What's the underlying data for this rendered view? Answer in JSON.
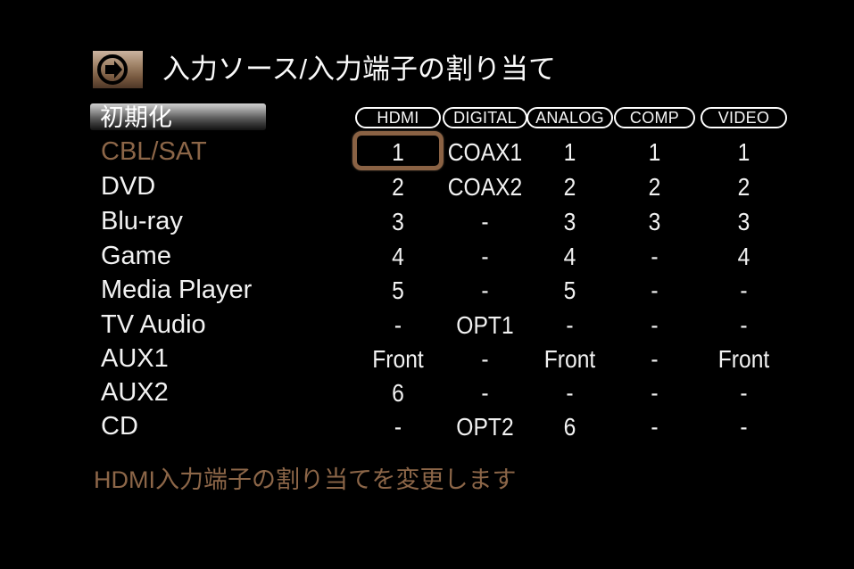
{
  "header": {
    "title": "入力ソース/入力端子の割り当て",
    "icon": "arrow-right-card-icon"
  },
  "highlight_row": {
    "label": "初期化"
  },
  "table": {
    "columns": [
      "HDMI",
      "DIGITAL",
      "ANALOG",
      "COMP",
      "VIDEO"
    ],
    "rows": [
      {
        "source": "CBL/SAT",
        "selected": true,
        "values": [
          "1",
          "COAX1",
          "1",
          "1",
          "1"
        ]
      },
      {
        "source": "DVD",
        "selected": false,
        "values": [
          "2",
          "COAX2",
          "2",
          "2",
          "2"
        ]
      },
      {
        "source": "Blu-ray",
        "selected": false,
        "values": [
          "3",
          "-",
          "3",
          "3",
          "3"
        ]
      },
      {
        "source": "Game",
        "selected": false,
        "values": [
          "4",
          "-",
          "4",
          "-",
          "4"
        ]
      },
      {
        "source": "Media Player",
        "selected": false,
        "values": [
          "5",
          "-",
          "5",
          "-",
          "-"
        ]
      },
      {
        "source": "TV Audio",
        "selected": false,
        "values": [
          "-",
          "OPT1",
          "-",
          "-",
          "-"
        ]
      },
      {
        "source": "AUX1",
        "selected": false,
        "values": [
          "Front",
          "-",
          "Front",
          "-",
          "Front"
        ]
      },
      {
        "source": "AUX2",
        "selected": false,
        "values": [
          "6",
          "-",
          "-",
          "-",
          "-"
        ]
      },
      {
        "source": "CD",
        "selected": false,
        "values": [
          "-",
          "OPT2",
          "6",
          "-",
          "-"
        ]
      }
    ],
    "selection": {
      "row": 0,
      "column": 0
    }
  },
  "footer": {
    "hint": "HDMI入力端子の割り当てを変更します"
  },
  "colors": {
    "background": "#000000",
    "accent_bronze": "#8c6648",
    "selection_border": "#8a6244",
    "text_primary": "#f2f2f2",
    "header_border": "#ffffff"
  }
}
